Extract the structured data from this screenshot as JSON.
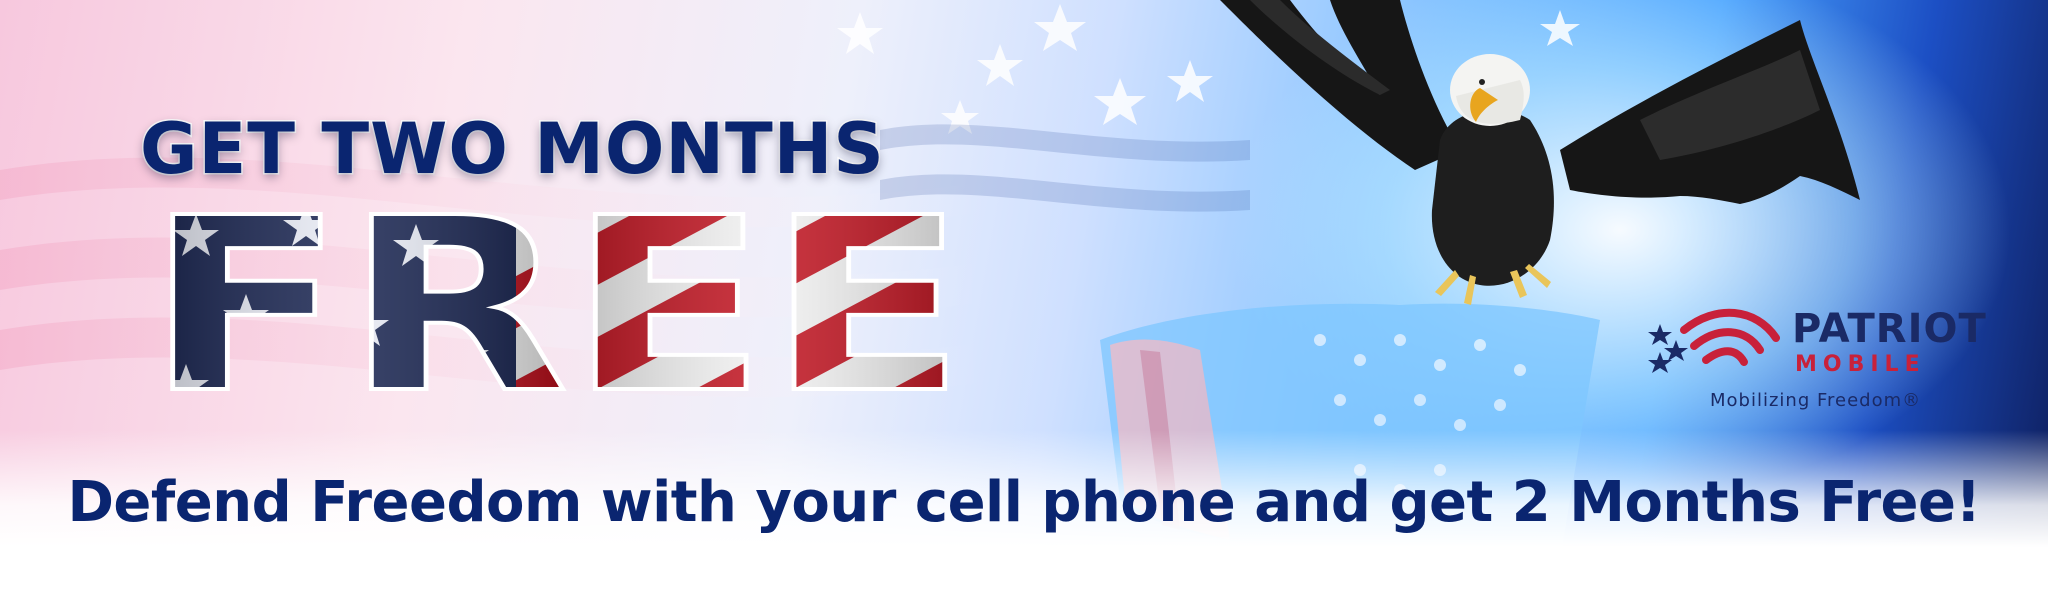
{
  "banner": {
    "headline_top": "GET TWO MONTHS",
    "headline_main": "FREE",
    "tagline": "Defend Freedom with your cell phone and get 2 Months Free!"
  },
  "logo": {
    "name": "PATRIOT",
    "subname": "MOBILE",
    "slogan": "Mobilizing Freedom®"
  },
  "colors": {
    "navy": "#0a2570",
    "red": "#c8213a",
    "logo_navy": "#1a2a66"
  },
  "imagery": [
    "american-flag",
    "bald-eagle",
    "stars"
  ]
}
